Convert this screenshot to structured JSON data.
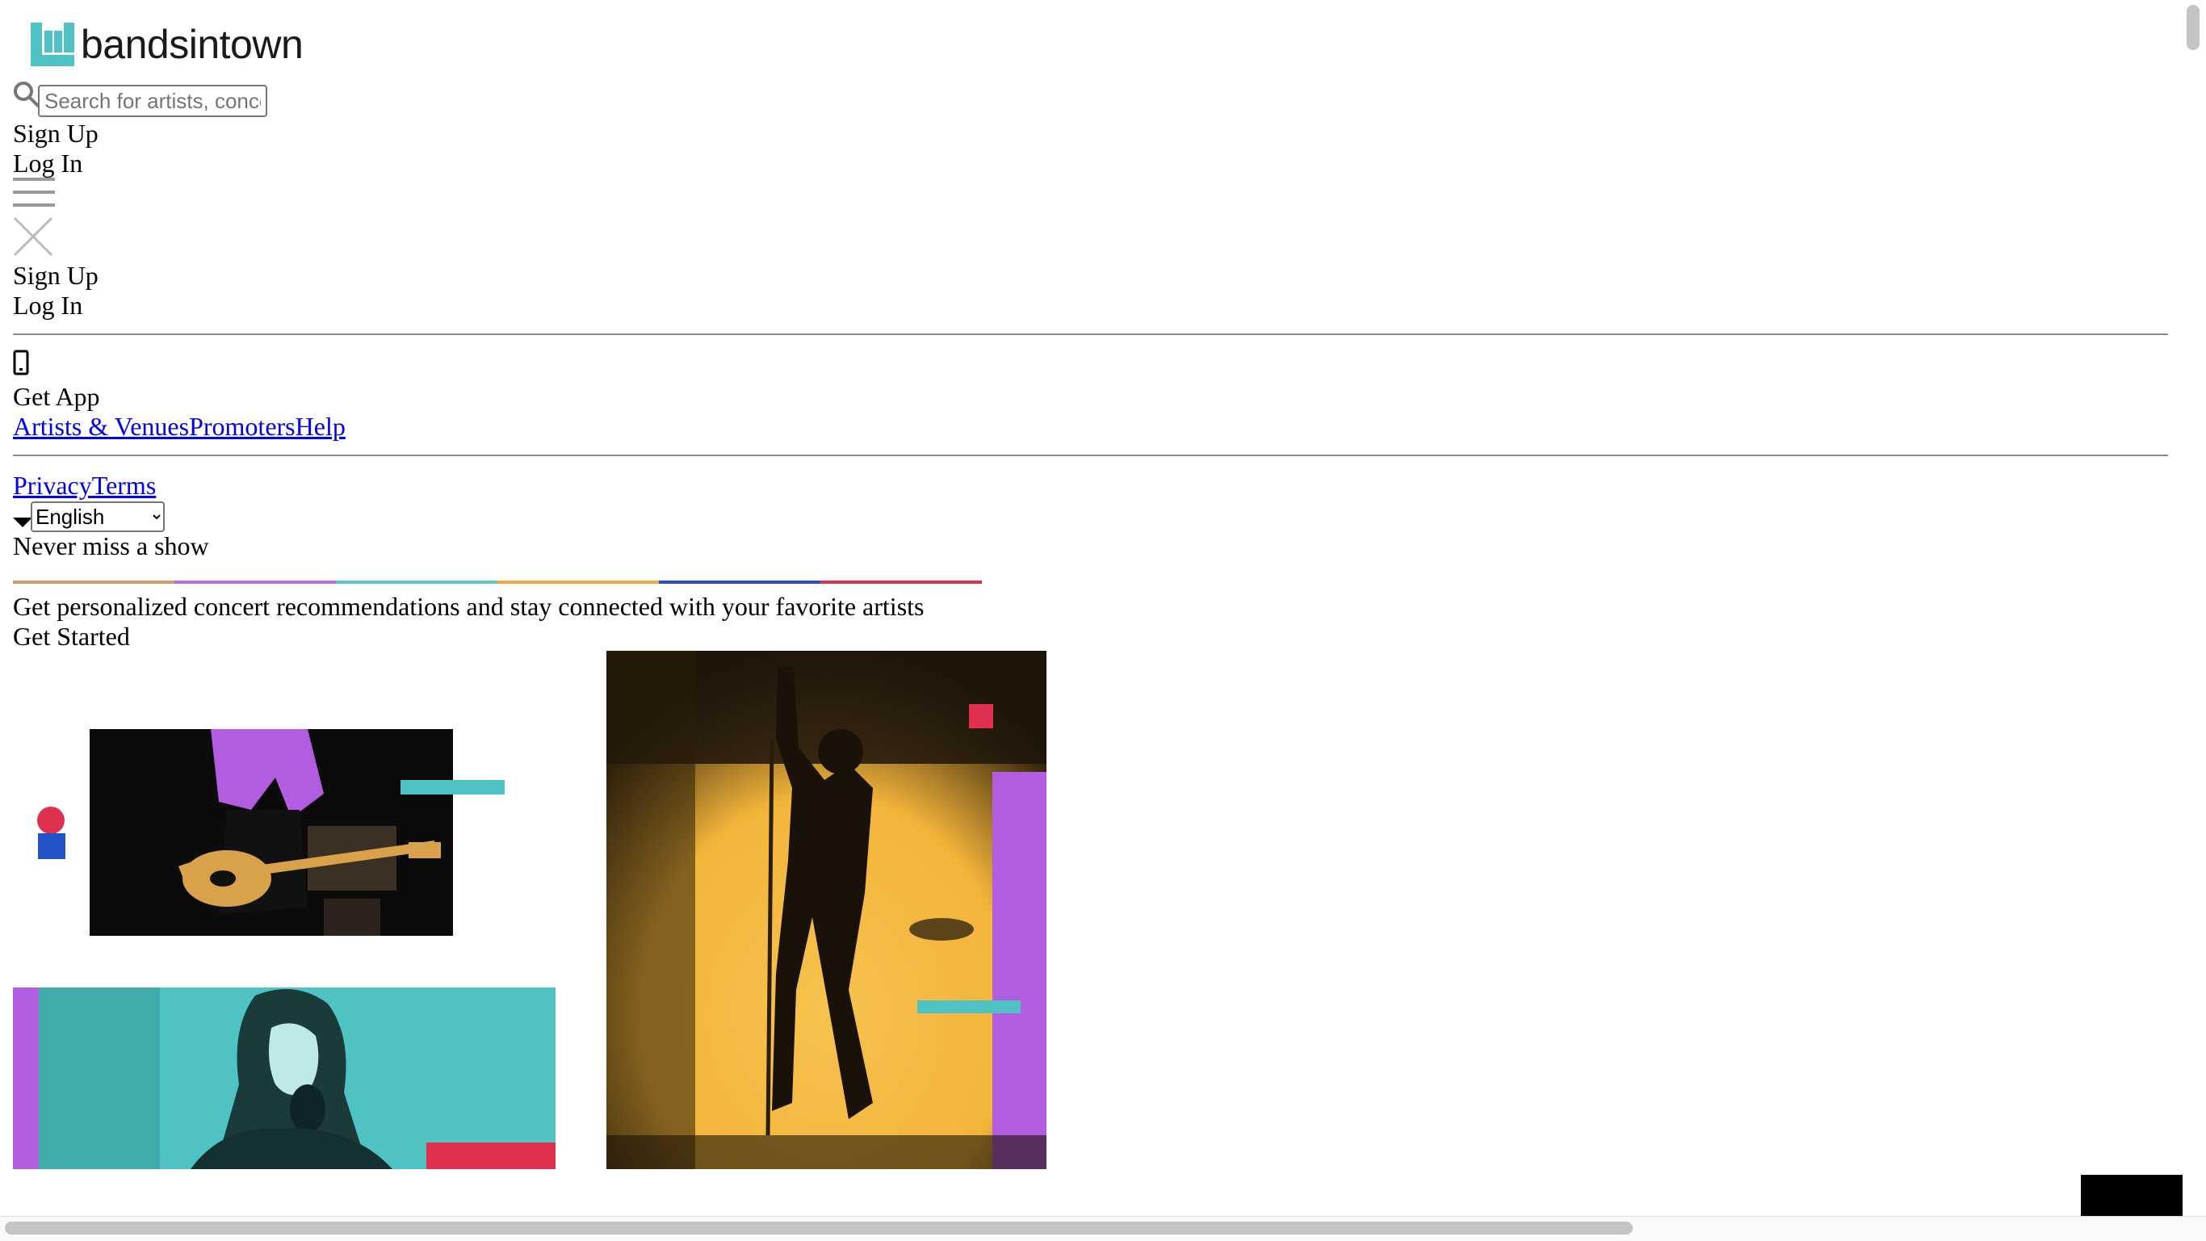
{
  "header": {
    "logo_text": "bandsintown",
    "search": {
      "placeholder": "Search for artists, concerts, venues",
      "value": ""
    },
    "signup_label": "Sign Up",
    "login_label": "Log In"
  },
  "menu": {
    "signup_label": "Sign Up",
    "login_label": "Log In",
    "get_app_label": "Get App",
    "links": {
      "artists_venues": "Artists & Venues",
      "promoters": "Promoters",
      "help": "Help"
    },
    "legal": {
      "privacy": "Privacy",
      "terms": "Terms"
    },
    "language": {
      "selected": "English",
      "options": [
        "English"
      ]
    }
  },
  "hero": {
    "title": "Never miss a show",
    "subtitle": "Get personalized concert recommendations and stay connected with your favorite artists",
    "cta_label": "Get Started",
    "bar_colors": [
      "#c9a062",
      "#b06ee0",
      "#5bc5c5",
      "#f0a840",
      "#2b4fcf",
      "#e0304f"
    ]
  },
  "colors": {
    "brand_teal": "#4fc3c3",
    "accent_pink": "#e0304f",
    "accent_blue": "#2355c9",
    "accent_purple": "#b25ce0",
    "photo_yellow": "#f3b43a"
  },
  "icons": {
    "logo": "bandsintown-logo-icon",
    "search": "search-icon",
    "menu": "hamburger-menu-icon",
    "close": "close-icon",
    "phone": "mobile-phone-icon",
    "dropdown": "caret-down-icon"
  }
}
